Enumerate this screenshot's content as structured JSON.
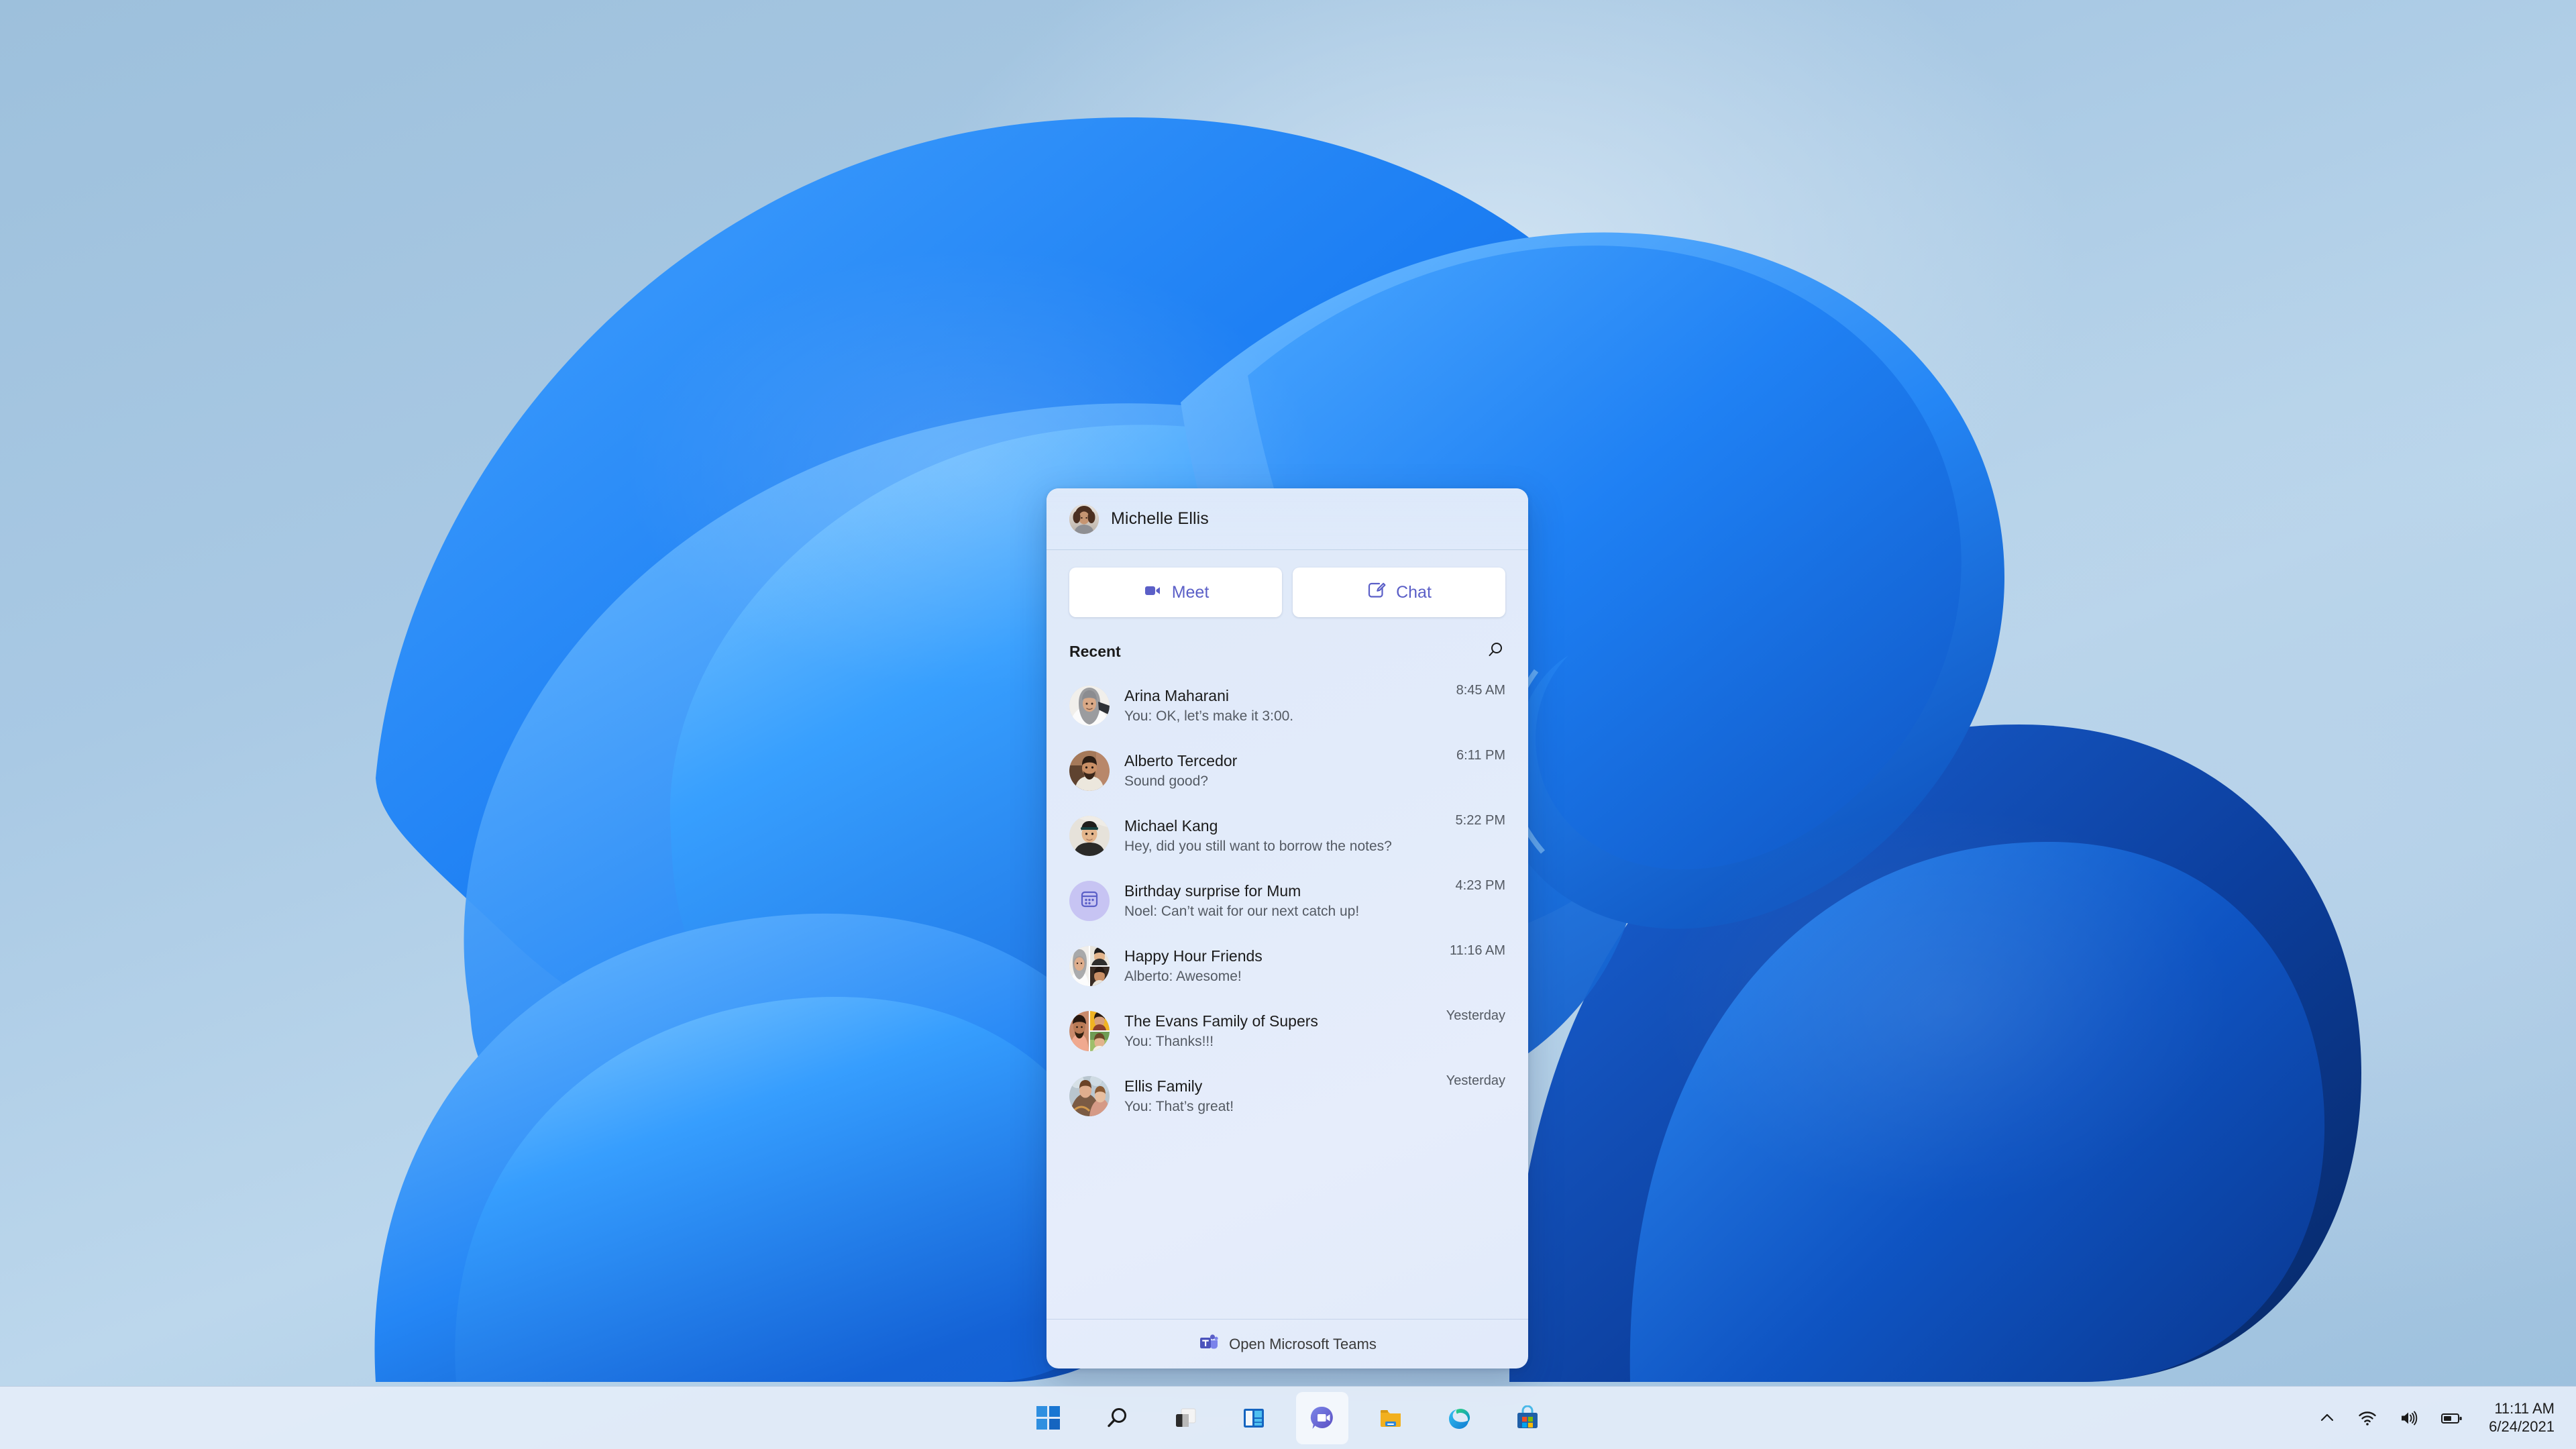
{
  "desktop": {
    "wallpaper_name": "windows-11-bloom-wallpaper",
    "background_color": "#9dc0dc",
    "bloom_color": "#1f7ef5"
  },
  "teams_flyout": {
    "header": {
      "user_name": "Michelle Ellis",
      "avatar_name": "michelle-ellis-avatar"
    },
    "actions": [
      {
        "id": "meet",
        "label": "Meet",
        "icon": "video-camera-icon"
      },
      {
        "id": "chat",
        "label": "Chat",
        "icon": "compose-chat-icon"
      }
    ],
    "recent": {
      "title": "Recent",
      "search_icon": "search-icon"
    },
    "chats": [
      {
        "name": "Arina Maharani",
        "preview": "You: OK, let’s make it 3:00.",
        "time": "8:45 AM",
        "avatar_type": "photo",
        "avatar_colors": [
          "#e8e6e2",
          "#8e9095",
          "#f2f1ef"
        ]
      },
      {
        "name": "Alberto Tercedor",
        "preview": "Sound good?",
        "time": "6:11 PM",
        "avatar_type": "photo",
        "avatar_colors": [
          "#9c6a4d",
          "#3b2a20",
          "#e3ded6"
        ]
      },
      {
        "name": "Michael Kang",
        "preview": "Hey, did you still want to borrow the notes?",
        "time": "5:22 PM",
        "avatar_type": "photo",
        "avatar_colors": [
          "#efece6",
          "#2c2a28",
          "#d8ccbd"
        ]
      },
      {
        "name": "Birthday surprise for Mum",
        "preview": "Noel: Can’t wait for our next catch up!",
        "time": "4:23 PM",
        "avatar_type": "group-icon",
        "avatar_colors": [
          "#c7c4f3",
          "#5b5fc7"
        ]
      },
      {
        "name": "Happy Hour Friends",
        "preview": "Alberto: Awesome!",
        "time": "11:16 AM",
        "avatar_type": "collage-3",
        "avatar_colors": [
          "#d8d4cc",
          "#cfd3d8",
          "#b08a6a"
        ]
      },
      {
        "name": "The Evans Family of Supers",
        "preview": "You: Thanks!!!",
        "time": "Yesterday",
        "avatar_type": "collage-3",
        "avatar_colors": [
          "#c98a6b",
          "#f0b323",
          "#9fbf6a"
        ]
      },
      {
        "name": "Ellis Family",
        "preview": "You: That’s great!",
        "time": "Yesterday",
        "avatar_type": "photo",
        "avatar_colors": [
          "#b9c6cf",
          "#d59a86",
          "#7b5b44"
        ]
      }
    ],
    "footer": {
      "label": "Open Microsoft Teams",
      "icon": "microsoft-teams-icon"
    },
    "accent_color": "#5b5fc7"
  },
  "taskbar": {
    "items": [
      {
        "id": "start",
        "name": "start-button",
        "icon": "windows-logo-icon",
        "active": false
      },
      {
        "id": "search",
        "name": "search-button",
        "icon": "search-icon",
        "active": false
      },
      {
        "id": "task-view",
        "name": "task-view-button",
        "icon": "task-view-icon",
        "active": false
      },
      {
        "id": "widgets",
        "name": "widgets-button",
        "icon": "widgets-icon",
        "active": false
      },
      {
        "id": "chat",
        "name": "chat-teams-button",
        "icon": "teams-chat-icon",
        "active": true
      },
      {
        "id": "file-explorer",
        "name": "file-explorer-button",
        "icon": "folder-icon",
        "active": false
      },
      {
        "id": "edge",
        "name": "microsoft-edge-button",
        "icon": "edge-icon",
        "active": false
      },
      {
        "id": "store",
        "name": "microsoft-store-button",
        "icon": "store-icon",
        "active": false
      }
    ],
    "tray": {
      "show_hidden_icons": "chevron-up-icon",
      "network": "wifi-icon",
      "volume": "speaker-icon",
      "battery": "battery-icon",
      "time": "11:11 AM",
      "date": "6/24/2021"
    }
  }
}
